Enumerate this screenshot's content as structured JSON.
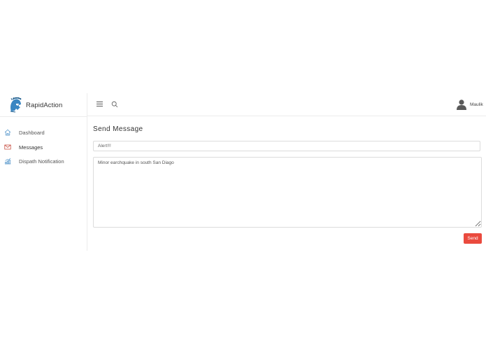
{
  "brand": {
    "name": "RapidAction"
  },
  "sidebar": {
    "items": [
      {
        "label": "Dashboard",
        "icon": "home-icon"
      },
      {
        "label": "Messages",
        "icon": "mail-icon"
      },
      {
        "label": "Dispath Notification",
        "icon": "chart-icon"
      }
    ]
  },
  "topbar": {
    "user_name": "Maulik"
  },
  "main": {
    "title": "Send Message",
    "subject_value": "Alert!!!",
    "message_value": "Minor earchquake in south San Diago",
    "send_label": "Send"
  },
  "colors": {
    "accent": "#ea4a3e",
    "icon_blue": "#4a90c8"
  }
}
